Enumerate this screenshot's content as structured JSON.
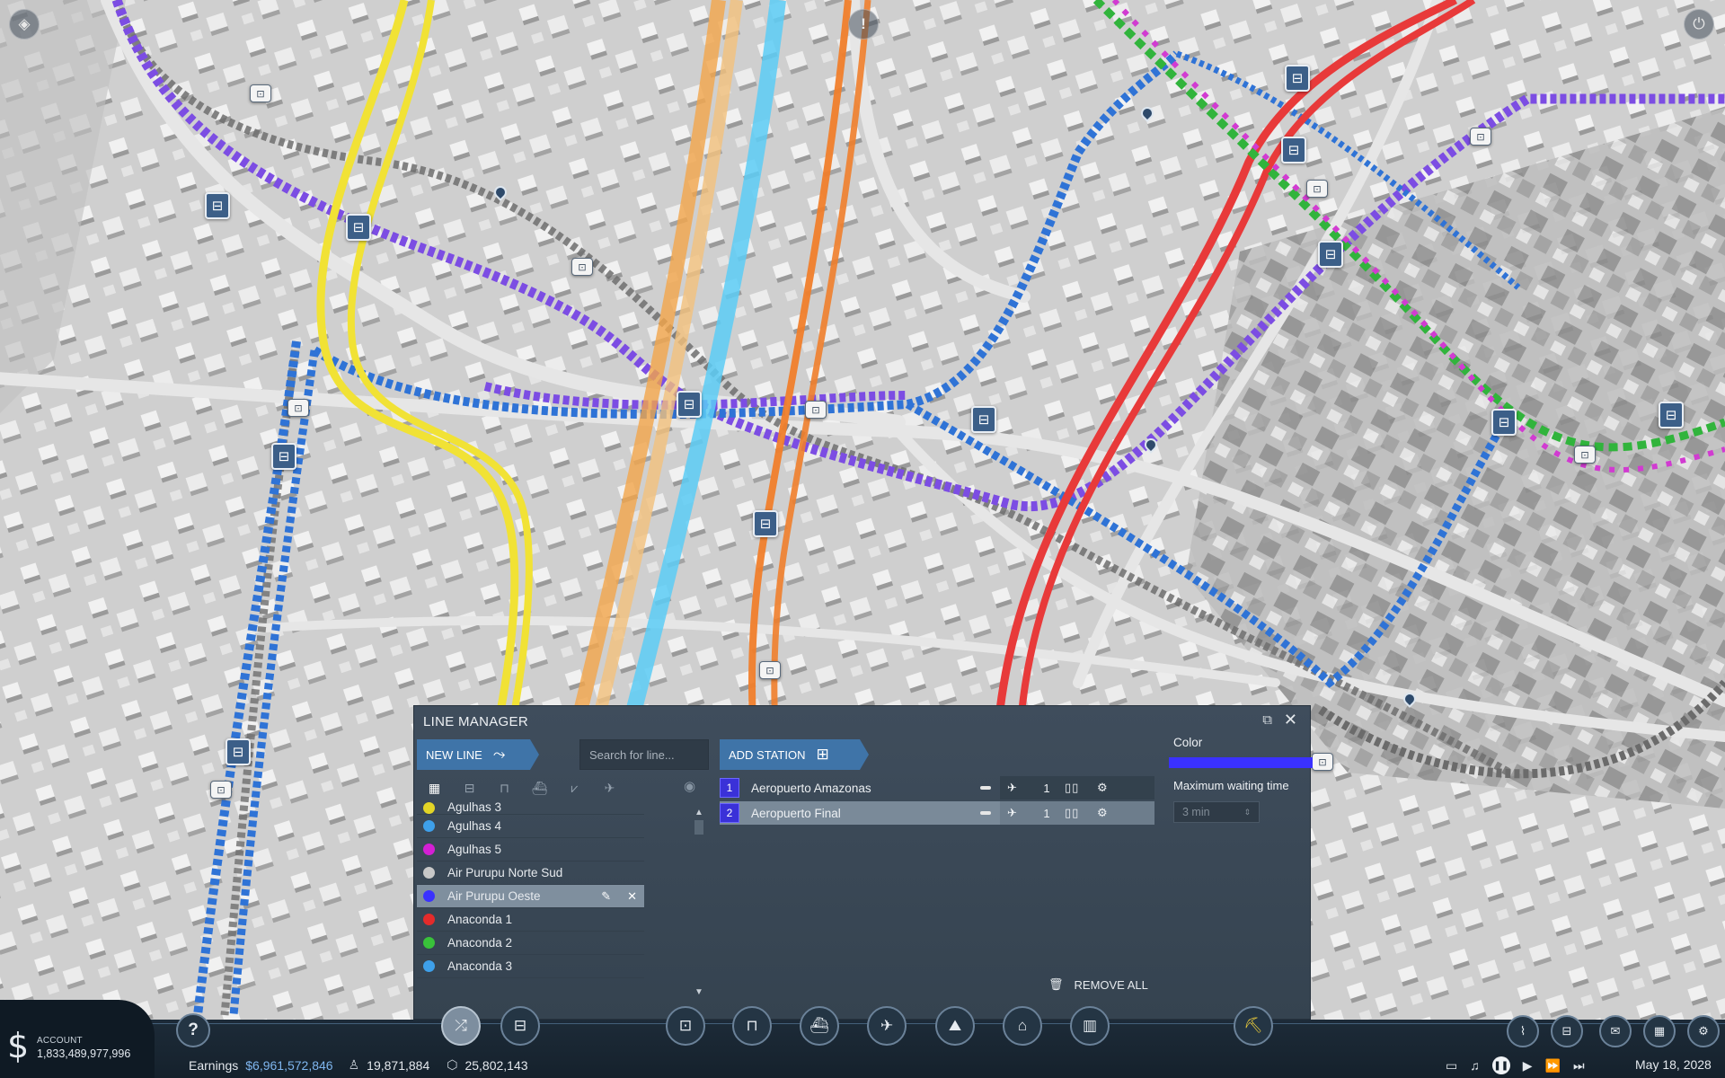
{
  "map": {
    "pins": 6
  },
  "line_manager": {
    "title": "LINE MANAGER",
    "popout_icon": "popout-icon",
    "close_icon": "close-icon",
    "new_line_label": "NEW LINE",
    "search_placeholder": "Search for line...",
    "add_station_label": "ADD STATION",
    "filters": [
      "all-icon",
      "bus-icon",
      "tram-icon",
      "ship-icon",
      "cargo-ship-icon",
      "plane-icon"
    ],
    "lines": [
      {
        "name": "Agulhas 3",
        "color": "#e3d526"
      },
      {
        "name": "Agulhas 4",
        "color": "#3ea0ea"
      },
      {
        "name": "Agulhas 5",
        "color": "#d41fd4"
      },
      {
        "name": "Air Purupu Norte Sud",
        "color": "#c8c8c8"
      },
      {
        "name": "Air Purupu Oeste",
        "color": "#3a31ff"
      },
      {
        "name": "Anaconda 1",
        "color": "#e42b2b"
      },
      {
        "name": "Anaconda 2",
        "color": "#39c23a"
      },
      {
        "name": "Anaconda 3",
        "color": "#3ea0ea"
      }
    ],
    "selected_line": "Air Purupu Oeste",
    "stations": [
      {
        "num": "1",
        "name": "Aeropuerto Amazonas",
        "count": "1"
      },
      {
        "num": "2",
        "name": "Aeropuerto Final",
        "count": "1"
      }
    ],
    "remove_all_label": "REMOVE ALL",
    "color_label": "Color",
    "color_value": "#3a31ff",
    "max_wait_label": "Maximum waiting time",
    "max_wait_value": "3 min"
  },
  "account": {
    "label": "ACCOUNT",
    "value": "1,833,489,977,996"
  },
  "stats": {
    "earnings_label": "Earnings",
    "earnings_value": "$6,961,572,846",
    "population": "19,871,884",
    "freight": "25,802,143"
  },
  "date": "May 18, 2028",
  "toolbar": {
    "center": [
      "bus-depot-icon",
      "train-icon",
      "ship-icon",
      "airplane-icon",
      "terrain-icon",
      "town-icon",
      "industry-icon"
    ],
    "right": [
      "track-icon",
      "vehicles-icon",
      "messages-icon",
      "cities-icon",
      "settings-icon"
    ]
  }
}
